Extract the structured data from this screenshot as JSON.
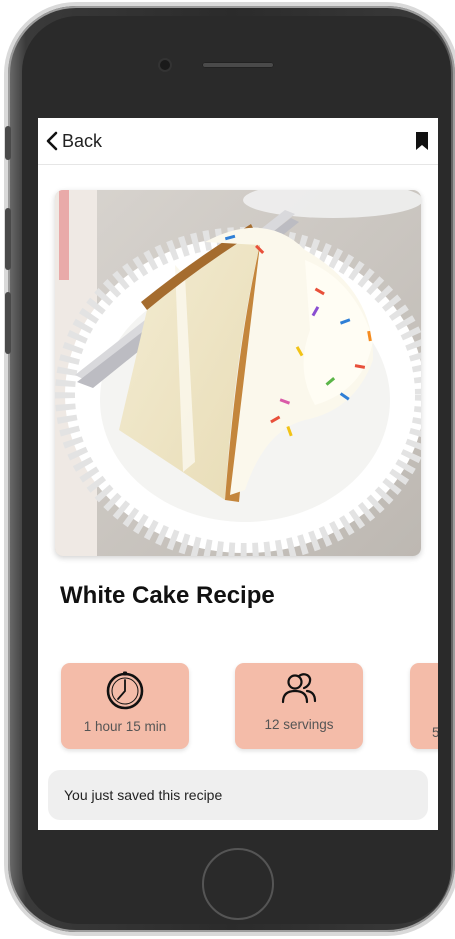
{
  "nav": {
    "back_label": "Back"
  },
  "recipe": {
    "title": "White Cake Recipe"
  },
  "info_cards": [
    {
      "label": "1 hour 15 min",
      "icon": "clock-icon"
    },
    {
      "label": "12 servings",
      "icon": "people-icon"
    },
    {
      "label": "5",
      "icon": "unknown-icon"
    }
  ],
  "toast": {
    "message": "You just saved this recipe"
  },
  "colors": {
    "card_bg": "#f4bca9",
    "toast_bg": "#efefef"
  }
}
